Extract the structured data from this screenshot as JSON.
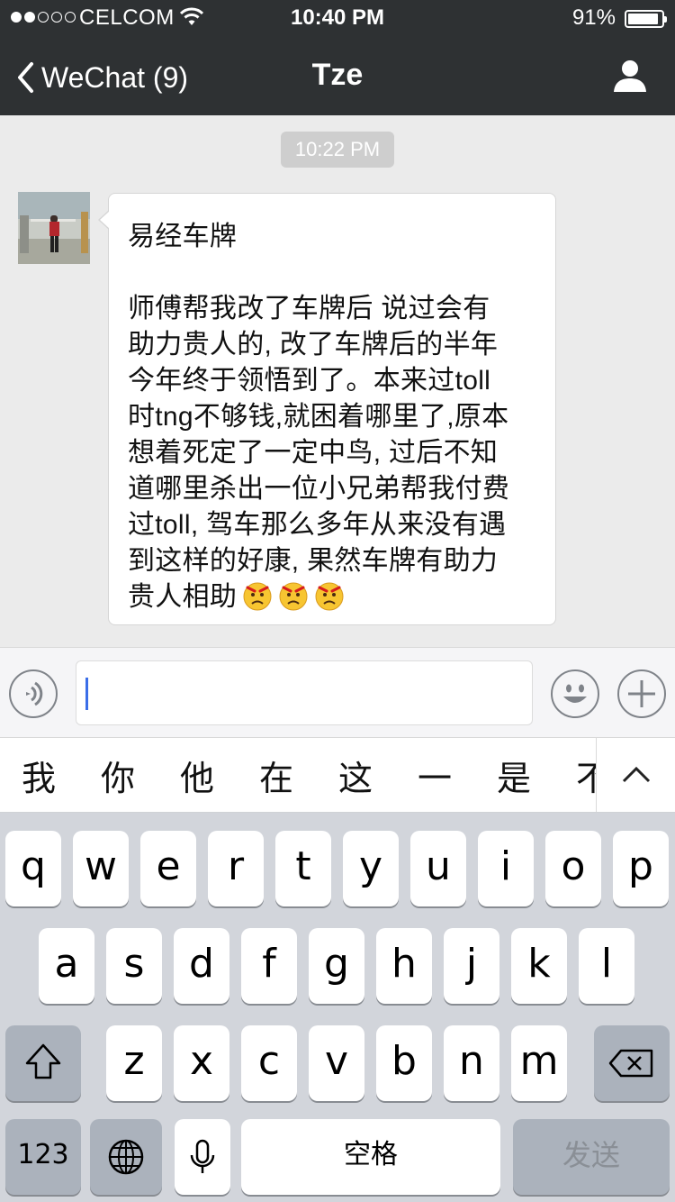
{
  "status_bar": {
    "carrier": "CELCOM",
    "time": "10:40 PM",
    "battery_percent": "91%",
    "signal_bars_filled": 2,
    "signal_bars_total": 5,
    "battery_level": 0.91
  },
  "nav": {
    "back_label": "WeChat (9)",
    "title": "Tze",
    "profile_icon": "person-icon"
  },
  "chat": {
    "timestamp": "10:22 PM",
    "message": {
      "lines": [
        "易经车牌",
        "",
        "师傅帮我改了车牌后 说过会有",
        "助力贵人的, 改了车牌后的半年",
        "今年终于领悟到了。本来过toll",
        "时tng不够钱,就困着哪里了,原本",
        "想着死定了一定中鸟, 过后不知",
        "道哪里杀出一位小兄弟帮我付费",
        "过toll, 驾车那么多年从来没有遇",
        "到这样的好康, 果然车牌有助力",
        "贵人相助"
      ],
      "emoji_icon": "angry-face-emoji",
      "emoji_count": 3
    }
  },
  "input_bar": {
    "voice_icon": "voice-icon",
    "text_value": "",
    "emoji_icon": "smiley-icon",
    "plus_icon": "plus-icon"
  },
  "candidates": {
    "items": [
      "我",
      "你",
      "他",
      "在",
      "这",
      "一",
      "是",
      "不"
    ],
    "expand_icon": "chevron-up-icon"
  },
  "keyboard": {
    "row1": [
      "q",
      "w",
      "e",
      "r",
      "t",
      "y",
      "u",
      "i",
      "o",
      "p"
    ],
    "row2": [
      "a",
      "s",
      "d",
      "f",
      "g",
      "h",
      "j",
      "k",
      "l"
    ],
    "row3": [
      "z",
      "x",
      "c",
      "v",
      "b",
      "n",
      "m"
    ],
    "numbers_label": "123",
    "space_label": "空格",
    "send_label": "发送",
    "shift_icon": "shift-icon",
    "delete_icon": "delete-icon",
    "globe_icon": "globe-icon",
    "mic_icon": "microphone-icon"
  }
}
